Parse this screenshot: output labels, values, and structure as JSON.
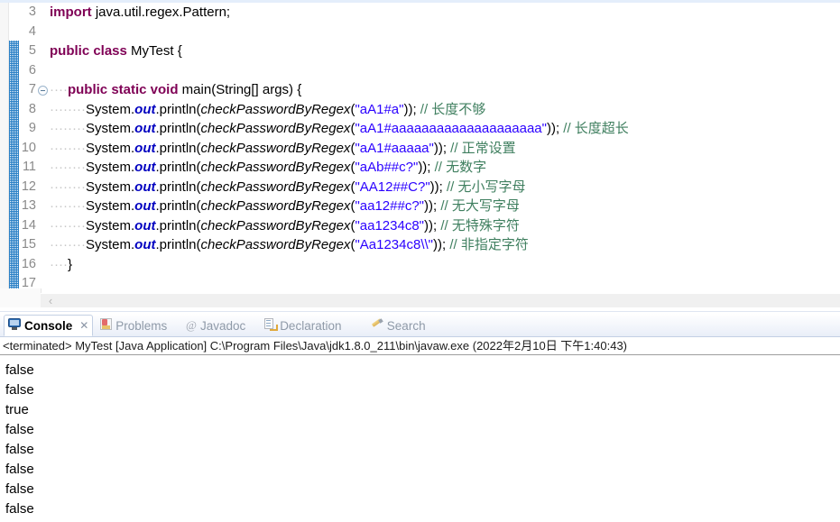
{
  "editor": {
    "lines": [
      {
        "num": "3",
        "fold": false,
        "indent": "",
        "tokens": [
          {
            "t": "kw",
            "v": "import"
          },
          {
            "t": "plain",
            "v": " java.util.regex.Pattern;"
          }
        ]
      },
      {
        "num": "4",
        "fold": false,
        "indent": "",
        "tokens": []
      },
      {
        "num": "5",
        "fold": false,
        "indent": "",
        "tokens": [
          {
            "t": "kw",
            "v": "public class"
          },
          {
            "t": "plain",
            "v": " MyTest {"
          }
        ]
      },
      {
        "num": "6",
        "fold": false,
        "indent": "",
        "tokens": []
      },
      {
        "num": "7",
        "fold": true,
        "indent": "····",
        "tokens": [
          {
            "t": "kw",
            "v": "public static void"
          },
          {
            "t": "plain",
            "v": " main(String[] args) {"
          }
        ]
      },
      {
        "num": "8",
        "fold": false,
        "indent": "········",
        "tokens": [
          {
            "t": "plain",
            "v": "System."
          },
          {
            "t": "field",
            "v": "out"
          },
          {
            "t": "plain",
            "v": ".println("
          },
          {
            "t": "method",
            "v": "checkPasswordByRegex"
          },
          {
            "t": "plain",
            "v": "("
          },
          {
            "t": "str",
            "v": "\"aA1#a\""
          },
          {
            "t": "plain",
            "v": ")); "
          },
          {
            "t": "cmt",
            "v": "// 长度不够"
          }
        ]
      },
      {
        "num": "9",
        "fold": false,
        "indent": "········",
        "tokens": [
          {
            "t": "plain",
            "v": "System."
          },
          {
            "t": "field",
            "v": "out"
          },
          {
            "t": "plain",
            "v": ".println("
          },
          {
            "t": "method",
            "v": "checkPasswordByRegex"
          },
          {
            "t": "plain",
            "v": "("
          },
          {
            "t": "str",
            "v": "\"aA1#aaaaaaaaaaaaaaaaaaaa\""
          },
          {
            "t": "plain",
            "v": ")); "
          },
          {
            "t": "cmt",
            "v": "// 长度超长"
          }
        ]
      },
      {
        "num": "10",
        "fold": false,
        "indent": "········",
        "tokens": [
          {
            "t": "plain",
            "v": "System."
          },
          {
            "t": "field",
            "v": "out"
          },
          {
            "t": "plain",
            "v": ".println("
          },
          {
            "t": "method",
            "v": "checkPasswordByRegex"
          },
          {
            "t": "plain",
            "v": "("
          },
          {
            "t": "str",
            "v": "\"aA1#aaaaa\""
          },
          {
            "t": "plain",
            "v": ")); "
          },
          {
            "t": "cmt",
            "v": "// 正常设置"
          }
        ]
      },
      {
        "num": "11",
        "fold": false,
        "indent": "········",
        "tokens": [
          {
            "t": "plain",
            "v": "System."
          },
          {
            "t": "field",
            "v": "out"
          },
          {
            "t": "plain",
            "v": ".println("
          },
          {
            "t": "method",
            "v": "checkPasswordByRegex"
          },
          {
            "t": "plain",
            "v": "("
          },
          {
            "t": "str",
            "v": "\"aAb##c?\""
          },
          {
            "t": "plain",
            "v": ")); "
          },
          {
            "t": "cmt",
            "v": "// 无数字"
          }
        ]
      },
      {
        "num": "12",
        "fold": false,
        "indent": "········",
        "tokens": [
          {
            "t": "plain",
            "v": "System."
          },
          {
            "t": "field",
            "v": "out"
          },
          {
            "t": "plain",
            "v": ".println("
          },
          {
            "t": "method",
            "v": "checkPasswordByRegex"
          },
          {
            "t": "plain",
            "v": "("
          },
          {
            "t": "str",
            "v": "\"AA12##C?\""
          },
          {
            "t": "plain",
            "v": ")); "
          },
          {
            "t": "cmt",
            "v": "// 无小写字母"
          }
        ]
      },
      {
        "num": "13",
        "fold": false,
        "indent": "········",
        "tokens": [
          {
            "t": "plain",
            "v": "System."
          },
          {
            "t": "field",
            "v": "out"
          },
          {
            "t": "plain",
            "v": ".println("
          },
          {
            "t": "method",
            "v": "checkPasswordByRegex"
          },
          {
            "t": "plain",
            "v": "("
          },
          {
            "t": "str",
            "v": "\"aa12##c?\""
          },
          {
            "t": "plain",
            "v": ")); "
          },
          {
            "t": "cmt",
            "v": "// 无大写字母"
          }
        ]
      },
      {
        "num": "14",
        "fold": false,
        "indent": "········",
        "tokens": [
          {
            "t": "plain",
            "v": "System."
          },
          {
            "t": "field",
            "v": "out"
          },
          {
            "t": "plain",
            "v": ".println("
          },
          {
            "t": "method",
            "v": "checkPasswordByRegex"
          },
          {
            "t": "plain",
            "v": "("
          },
          {
            "t": "str",
            "v": "\"aa1234c8\""
          },
          {
            "t": "plain",
            "v": ")); "
          },
          {
            "t": "cmt",
            "v": "// 无特殊字符"
          }
        ]
      },
      {
        "num": "15",
        "fold": false,
        "indent": "········",
        "tokens": [
          {
            "t": "plain",
            "v": "System."
          },
          {
            "t": "field",
            "v": "out"
          },
          {
            "t": "plain",
            "v": ".println("
          },
          {
            "t": "method",
            "v": "checkPasswordByRegex"
          },
          {
            "t": "plain",
            "v": "("
          },
          {
            "t": "str",
            "v": "\"Aa1234c8\\\\\""
          },
          {
            "t": "plain",
            "v": ")); "
          },
          {
            "t": "cmt",
            "v": "// 非指定字符"
          }
        ]
      },
      {
        "num": "16",
        "fold": false,
        "indent": "····",
        "tokens": [
          {
            "t": "plain",
            "v": "}"
          }
        ]
      },
      {
        "num": "17",
        "fold": false,
        "indent": "",
        "tokens": []
      }
    ],
    "scroll_left_arrow": "‹"
  },
  "console": {
    "tabs": [
      {
        "label": "Console",
        "icon": "monitor-icon",
        "active": true,
        "close": "✕"
      },
      {
        "label": "Problems",
        "icon": "problems-icon",
        "active": false
      },
      {
        "label": "Javadoc",
        "icon": "at-icon",
        "active": false
      },
      {
        "label": "Declaration",
        "icon": "declaration-icon",
        "active": false
      },
      {
        "label": "Search",
        "icon": "search-pencil-icon",
        "active": false
      }
    ],
    "terminated_line": "<terminated> MyTest [Java Application] C:\\Program Files\\Java\\jdk1.8.0_211\\bin\\javaw.exe (2022年2月10日 下午1:40:43)",
    "output": [
      "false",
      "false",
      "true",
      "false",
      "false",
      "false",
      "false",
      "false"
    ]
  },
  "colors": {
    "keyword": "#7f0055",
    "string": "#2a00ff",
    "comment": "#3f7f5f",
    "field": "#0000c0",
    "line_number": "#8a8a8a",
    "change_bar": "#1f7ac4"
  }
}
